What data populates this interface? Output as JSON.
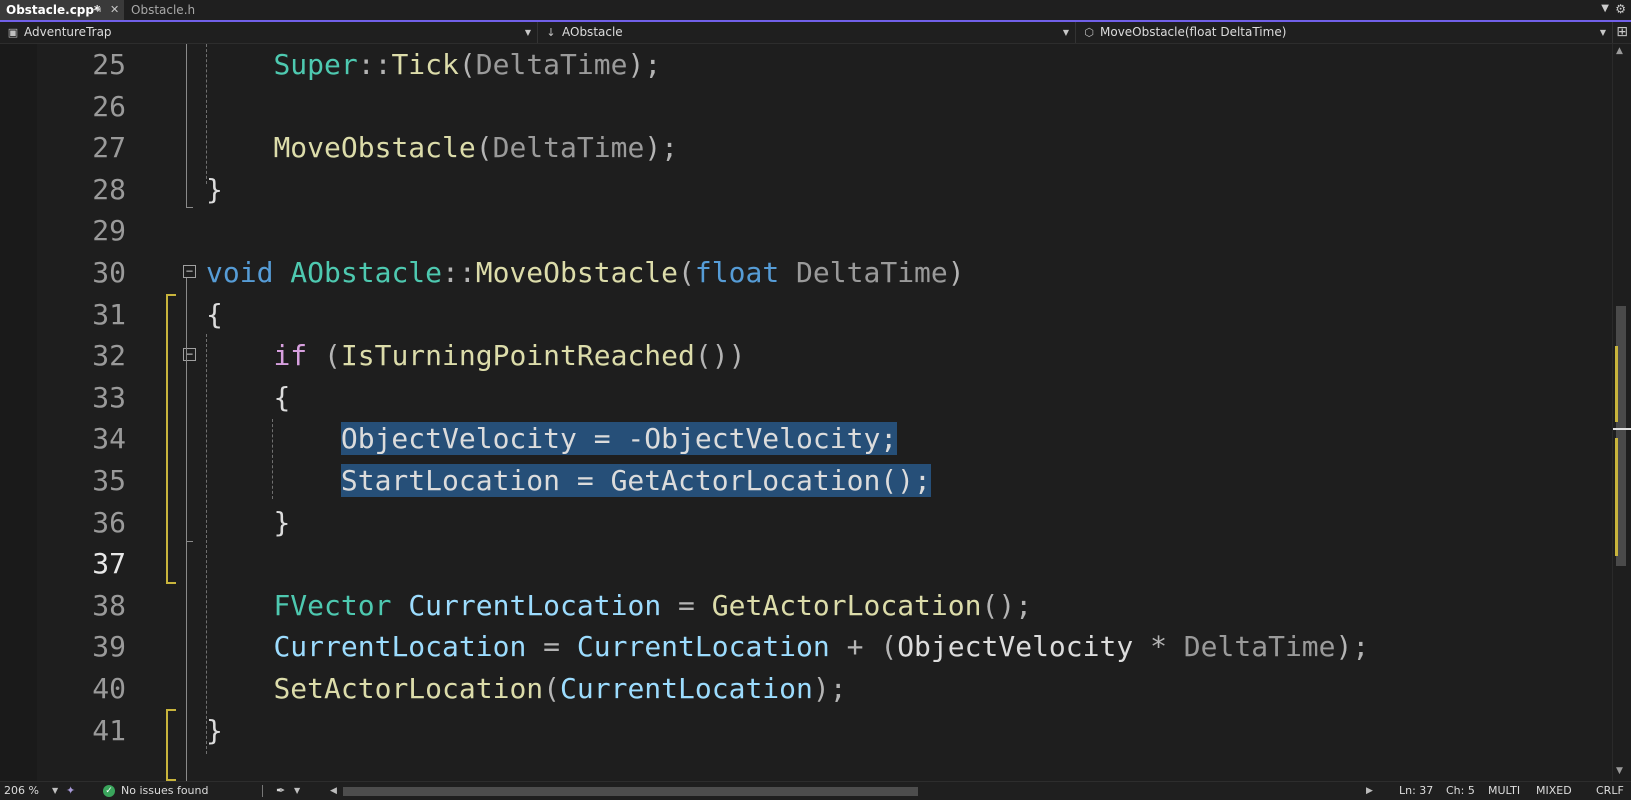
{
  "tabs": [
    {
      "label": "Obstacle.cpp*",
      "active": true
    },
    {
      "label": "Obstacle.h",
      "active": false
    }
  ],
  "nav": {
    "project": "AdventureTrap",
    "class": "AObstacle",
    "member": "MoveObstacle(float DeltaTime)"
  },
  "editor": {
    "current_line": 37,
    "lines": [
      {
        "n": "25",
        "tokens": [
          {
            "t": "    "
          },
          {
            "t": "Super",
            "k": "type"
          },
          {
            "t": "::",
            "k": "op"
          },
          {
            "t": "Tick",
            "k": "fn"
          },
          {
            "t": "(",
            "k": "op"
          },
          {
            "t": "DeltaTime",
            "k": "param"
          },
          {
            "t": ");",
            "k": "op"
          }
        ]
      },
      {
        "n": "26",
        "tokens": []
      },
      {
        "n": "27",
        "tokens": [
          {
            "t": "    "
          },
          {
            "t": "MoveObstacle",
            "k": "fn"
          },
          {
            "t": "(",
            "k": "op"
          },
          {
            "t": "DeltaTime",
            "k": "param"
          },
          {
            "t": ");",
            "k": "op"
          }
        ]
      },
      {
        "n": "28",
        "tokens": [
          {
            "t": "}",
            "k": "plain"
          }
        ]
      },
      {
        "n": "29",
        "tokens": []
      },
      {
        "n": "30",
        "tokens": [
          {
            "t": "void",
            "k": "kw"
          },
          {
            "t": " "
          },
          {
            "t": "AObstacle",
            "k": "type"
          },
          {
            "t": "::",
            "k": "op"
          },
          {
            "t": "MoveObstacle",
            "k": "fn"
          },
          {
            "t": "(",
            "k": "op"
          },
          {
            "t": "float",
            "k": "kw"
          },
          {
            "t": " "
          },
          {
            "t": "DeltaTime",
            "k": "param"
          },
          {
            "t": ")",
            "k": "op"
          }
        ]
      },
      {
        "n": "31",
        "tokens": [
          {
            "t": "{",
            "k": "plain"
          }
        ]
      },
      {
        "n": "32",
        "tokens": [
          {
            "t": "    "
          },
          {
            "t": "if",
            "k": "ctrl"
          },
          {
            "t": " "
          },
          {
            "t": "(",
            "k": "op"
          },
          {
            "t": "IsTurningPointReached",
            "k": "fn"
          },
          {
            "t": "())",
            "k": "op"
          }
        ]
      },
      {
        "n": "33",
        "tokens": [
          {
            "t": "    "
          },
          {
            "t": "{",
            "k": "plain"
          }
        ]
      },
      {
        "n": "34",
        "tokens": [
          {
            "t": "        "
          },
          {
            "t": "ObjectVelocity = -ObjectVelocity;",
            "k": "plain",
            "sel": true
          }
        ]
      },
      {
        "n": "35",
        "tokens": [
          {
            "t": "        "
          },
          {
            "t": "StartLocation = GetActorLocation();",
            "k": "plain",
            "sel": true
          }
        ]
      },
      {
        "n": "36",
        "tokens": [
          {
            "t": "    "
          },
          {
            "t": "}",
            "k": "plain"
          }
        ]
      },
      {
        "n": "37",
        "tokens": []
      },
      {
        "n": "38",
        "tokens": [
          {
            "t": "    "
          },
          {
            "t": "FVector",
            "k": "type"
          },
          {
            "t": " "
          },
          {
            "t": "CurrentLocation",
            "k": "var"
          },
          {
            "t": " = ",
            "k": "op"
          },
          {
            "t": "GetActorLocation",
            "k": "fn"
          },
          {
            "t": "();",
            "k": "op"
          }
        ]
      },
      {
        "n": "39",
        "tokens": [
          {
            "t": "    "
          },
          {
            "t": "CurrentLocation",
            "k": "var"
          },
          {
            "t": " = ",
            "k": "op"
          },
          {
            "t": "CurrentLocation",
            "k": "var"
          },
          {
            "t": " + (",
            "k": "op"
          },
          {
            "t": "ObjectVelocity",
            "k": "plain"
          },
          {
            "t": " * ",
            "k": "op"
          },
          {
            "t": "DeltaTime",
            "k": "param"
          },
          {
            "t": ");",
            "k": "op"
          }
        ]
      },
      {
        "n": "40",
        "tokens": [
          {
            "t": "    "
          },
          {
            "t": "SetActorLocation",
            "k": "fn"
          },
          {
            "t": "(",
            "k": "op"
          },
          {
            "t": "CurrentLocation",
            "k": "var"
          },
          {
            "t": ");",
            "k": "op"
          }
        ]
      },
      {
        "n": "41",
        "tokens": [
          {
            "t": "}",
            "k": "plain"
          }
        ]
      }
    ]
  },
  "status": {
    "zoom": "206 %",
    "issues": "No issues found",
    "ln": "Ln: 37",
    "ch": "Ch: 5",
    "insert_mode": "MULTI",
    "tabs_mode": "MIXED",
    "line_endings": "CRLF"
  },
  "colors": {
    "accent": "#7160e8",
    "selection": "#264f78",
    "keyword": "#569cd6",
    "control": "#d8a0df",
    "type": "#4ec9b0",
    "function": "#dcdcaa",
    "variable": "#9cdcfe",
    "change_marker": "#c8b43c"
  }
}
